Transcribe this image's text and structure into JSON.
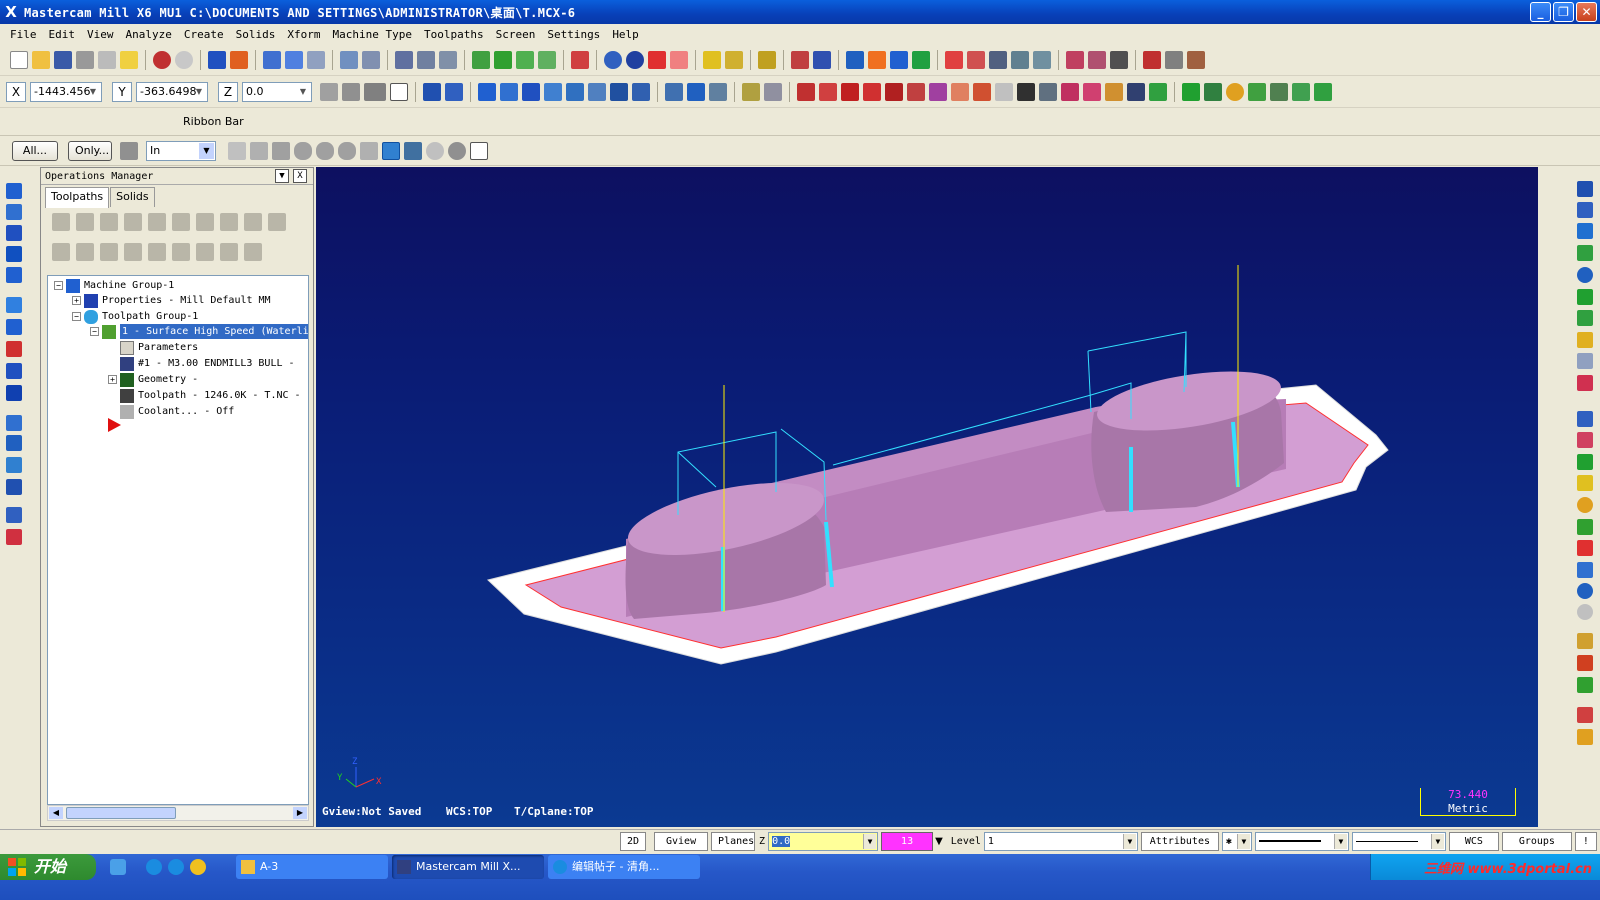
{
  "window": {
    "title": "Mastercam Mill X6 MU1  C:\\DOCUMENTS AND SETTINGS\\ADMINISTRATOR\\桌面\\T.MCX-6",
    "app_icon": "X"
  },
  "menu": [
    "File",
    "Edit",
    "View",
    "Analyze",
    "Create",
    "Solids",
    "Xform",
    "Machine Type",
    "Toolpaths",
    "Screen",
    "Settings",
    "Help"
  ],
  "coords": {
    "x_label": "X",
    "x_value": "-1443.456",
    "y_label": "Y",
    "y_value": "-363.6498",
    "z_label": "Z",
    "z_value": "0.0"
  },
  "ribbon_label": "Ribbon Bar",
  "selection_bar": {
    "all_label": "All...",
    "only_label": "Only...",
    "mode_value": "In"
  },
  "ops_manager": {
    "title": "Operations Manager",
    "tabs": [
      "Toolpaths",
      "Solids"
    ],
    "tree": {
      "machine_group": "Machine Group-1",
      "properties": "Properties - Mill Default MM",
      "toolpath_group": "Toolpath Group-1",
      "operation": "1 - Surface High Speed (Waterli",
      "parameters": "Parameters",
      "tool": "#1 - M3.00 ENDMILL3 BULL -",
      "geometry": "Geometry -",
      "toolpath": "Toolpath - 1246.0K - T.NC -",
      "coolant": "Coolant... - Off"
    }
  },
  "viewport": {
    "gview": "Gview:Not Saved",
    "wcs": "WCS:TOP",
    "tcplane": "T/Cplane:TOP",
    "scale_value": "73.440",
    "scale_unit": "Metric",
    "axis_x": "X",
    "axis_y": "Y",
    "axis_z": "Z"
  },
  "statusbar": {
    "mode_2d": "2D",
    "gview": "Gview",
    "planes": "Planes",
    "z_label": "Z",
    "z_value": "0.0",
    "color_value": "13",
    "level_label": "Level",
    "level_value": "1",
    "attributes": "Attributes",
    "wcs": "WCS",
    "groups": "Groups",
    "help": "!",
    "question": "?"
  },
  "taskbar": {
    "start": "开始",
    "tasks": [
      "A-3",
      "Mastercam Mill X...",
      "编辑帖子 - 清角..."
    ],
    "watermark": "三维网 www.3dportal.cn"
  },
  "colors": {
    "viewport_top": "#0d1060",
    "part_pink": "#d8a0d8",
    "toolpath_cyan": "#33e0ff",
    "stock_white": "#ffffff",
    "scale_magenta": "#ff33ff"
  }
}
